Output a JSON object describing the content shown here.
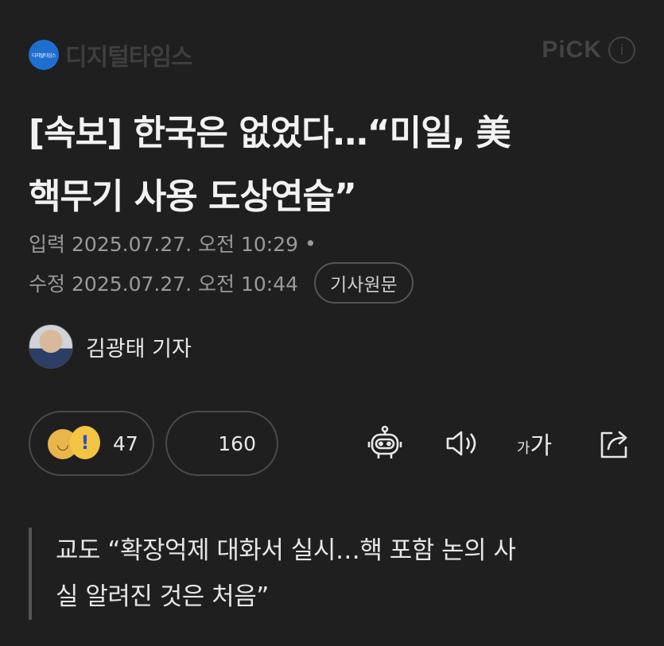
{
  "brand": {
    "logo_text": "디지털타임스",
    "name": "디지털타임스"
  },
  "pick": {
    "label": "PiCK",
    "info_glyph": "i"
  },
  "article": {
    "headline_line1": "[속보] 한국은 없었다…“미일, 美",
    "headline_line2": "핵무기 사용 도상연습”",
    "input_label": "입력",
    "input_date": "2025.07.27. 오전 10:29",
    "bullet": "•",
    "modified_label": "수정",
    "modified_date": "2025.07.27. 오전 10:44",
    "original_button": "기사원문",
    "reporter": "김광태 기자",
    "subtitle_line1": "교도 “확장억제 대화서 실시…핵 포함 논의 사",
    "subtitle_line2": "실 알려진 것은 처음”"
  },
  "reactions": {
    "reaction_count": "47",
    "comment_count": "160"
  },
  "tools": {
    "font_small": "가",
    "font_big": "가",
    "icons": [
      "ai-bot-icon",
      "speaker-icon",
      "font-size-icon",
      "share-icon"
    ]
  },
  "colors": {
    "background": "#1f1f1f",
    "brand_blue": "#1f6fd1",
    "reaction_yellow": "#f4c542"
  }
}
